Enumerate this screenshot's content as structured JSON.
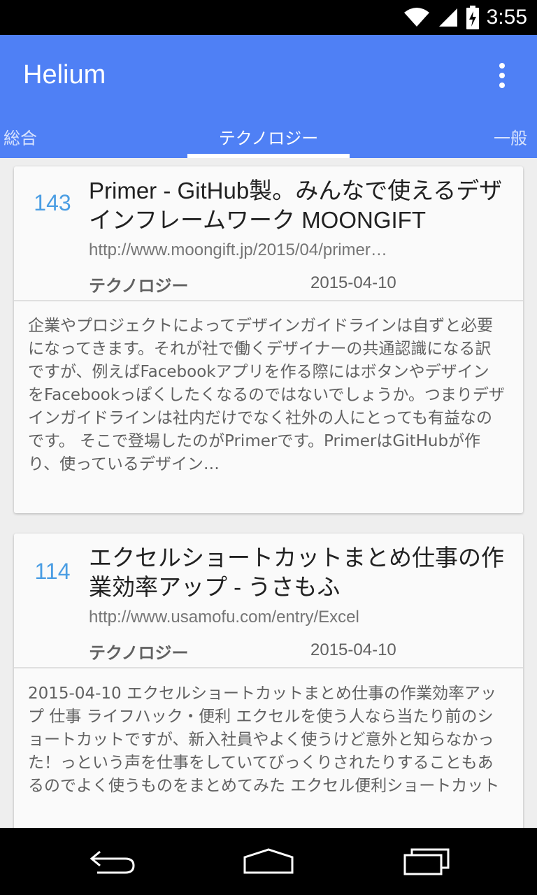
{
  "status_bar": {
    "time": "3:55",
    "icons": [
      "wifi-icon",
      "cell-signal-icon",
      "battery-charging-icon"
    ]
  },
  "app_bar": {
    "title": "Helium",
    "menu_icon": "overflow-menu-icon"
  },
  "tabs": [
    {
      "label": "総合",
      "active": false
    },
    {
      "label": "テクノロジー",
      "active": true
    },
    {
      "label": "一般",
      "active": false
    }
  ],
  "entries": [
    {
      "count": "143",
      "title": "Primer - GitHub製。みんなで使えるデザインフレームワーク MOONGIFT",
      "url": "http://www.moongift.jp/2015/04/primer…",
      "category": "テクノロジー",
      "date": "2015-04-10",
      "summary": "企業やプロジェクトによってデザインガイドラインは自ずと必要になってきます。それが社で働くデザイナーの共通認識になる訳ですが、例えばFacebookアプリを作る際にはボタンやデザインをFacebookっぽくしたくなるのではないでしょうか。つまりデザインガイドラインは社内だけでなく社外の人にとっても有益なのです。 そこで登場したのがPrimerです。PrimerはGitHubが作り、使っているデザイン…"
    },
    {
      "count": "114",
      "title": "エクセルショートカットまとめ仕事の作業効率アップ - うさもふ",
      "url": "http://www.usamofu.com/entry/Excel",
      "category": "テクノロジー",
      "date": "2015-04-10",
      "summary": "2015-04-10 エクセルショートカットまとめ仕事の作業効率アップ 仕事 ライフハック・便利 エクセルを使う人なら当たり前のショートカットですが、新入社員やよく使うけど意外と知らなかった！っという声を仕事をしていてびっくりされたりすることもあるのでよく使うものをまとめてみた エクセル便利ショートカット"
    }
  ],
  "nav_bar": {
    "buttons": [
      "back-icon",
      "home-icon",
      "recents-icon"
    ]
  },
  "colors": {
    "primary": "#4f80f5",
    "count": "#4a9de3",
    "background": "#eeeeee"
  }
}
